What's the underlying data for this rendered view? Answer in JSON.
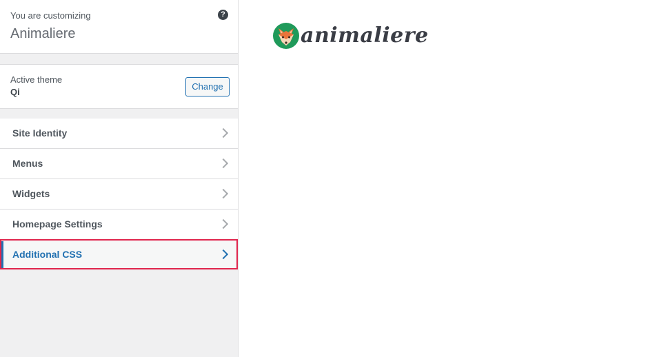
{
  "header": {
    "label": "You are customizing",
    "site_title": "Animaliere",
    "help_icon": "question-circle-icon",
    "help_glyph": "?"
  },
  "theme": {
    "label": "Active theme",
    "name": "Qi",
    "change_label": "Change"
  },
  "menu": {
    "items": [
      {
        "label": "Site Identity",
        "icon": "chevron-right-icon"
      },
      {
        "label": "Menus",
        "icon": "chevron-right-icon"
      },
      {
        "label": "Widgets",
        "icon": "chevron-right-icon"
      },
      {
        "label": "Homepage Settings",
        "icon": "chevron-right-icon"
      },
      {
        "label": "Additional CSS",
        "icon": "chevron-right-icon",
        "highlighted": true
      }
    ]
  },
  "preview": {
    "logo_icon": "fox-logo-icon",
    "logo_text": "animaliere"
  },
  "colors": {
    "accent": "#2271b1",
    "highlight_border": "#e0254d",
    "logo_green": "#1f9a5a",
    "logo_orange": "#e8743b"
  }
}
